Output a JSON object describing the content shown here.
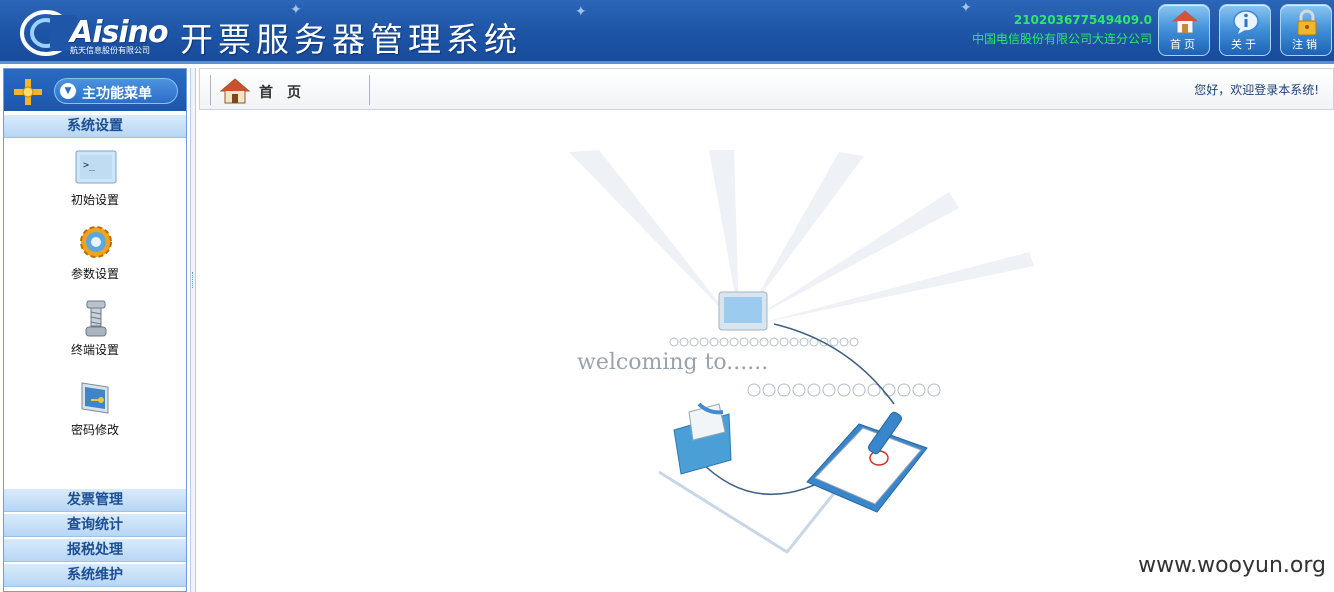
{
  "header": {
    "logo_text": "Aisino",
    "logo_subtitle": "航天信息股份有限公司",
    "system_title": "开票服务器管理系统",
    "account_id": "210203677549409.0",
    "company_name": "中国电信股份有限公司大连分公司",
    "buttons": [
      {
        "label": "首页",
        "icon": "home-icon"
      },
      {
        "label": "关于",
        "icon": "info-icon"
      },
      {
        "label": "注销",
        "icon": "lock-icon"
      }
    ]
  },
  "sidebar": {
    "menu_title": "主功能菜单",
    "active_section": "系统设置",
    "functions": [
      {
        "label": "初始设置",
        "icon": "terminal-icon"
      },
      {
        "label": "参数设置",
        "icon": "gear-icon"
      },
      {
        "label": "终端设置",
        "icon": "screw-icon"
      },
      {
        "label": "密码修改",
        "icon": "monitor-key-icon"
      }
    ],
    "sections": [
      "发票管理",
      "查询统计",
      "报税处理",
      "系统维护"
    ]
  },
  "tabbar": {
    "home_tab": "首页",
    "welcome_message": "您好，欢迎登录本系统!"
  },
  "content": {
    "welcoming_text": "welcoming to......",
    "watermark": "www.wooyun.org"
  }
}
